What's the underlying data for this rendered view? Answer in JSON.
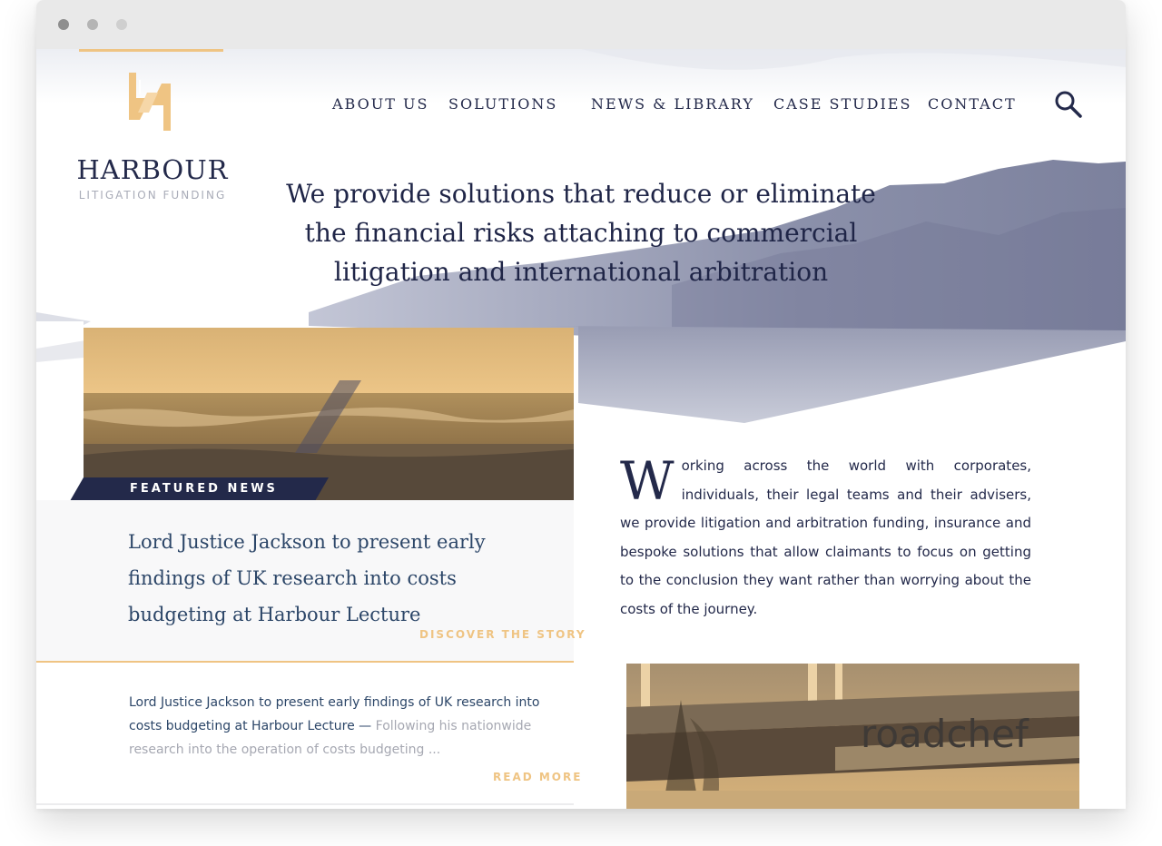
{
  "brand": {
    "name": "HARBOUR",
    "tagline": "LITIGATION FUNDING",
    "accent_color": "#efc483",
    "navy_color": "#23294a"
  },
  "nav": {
    "items": [
      {
        "label": "ABOUT US"
      },
      {
        "label": "SOLUTIONS"
      },
      {
        "label": "NEWS & LIBRARY"
      },
      {
        "label": "CASE STUDIES"
      },
      {
        "label": "CONTACT"
      }
    ],
    "search_icon": "search-icon"
  },
  "hero": {
    "headline": "We provide solutions that reduce or eliminate the financial risks attaching to commercial litigation and international arbitration"
  },
  "featured": {
    "label": "FEATURED NEWS",
    "title": "Lord Justice Jackson to present early findings of UK research into costs budgeting at Harbour Lecture",
    "cta": "DISCOVER THE STORY"
  },
  "news_item": {
    "link_text": "Lord Justice Jackson to present early findings of UK research into costs budgeting at Harbour Lecture —",
    "excerpt": " Following his nationwide research into the operation of costs budgeting ...",
    "cta": "READ MORE"
  },
  "intro": {
    "dropcap": "W",
    "text": "orking across the world with corporates, individuals, their legal teams and their advisers, we provide litigation and arbitration funding, insurance and bespoke solutions that allow claimants to focus on getting to the conclusion they want rather than worrying about the costs of the journey."
  },
  "case_study": {
    "image_sign_text": "roadchef"
  }
}
